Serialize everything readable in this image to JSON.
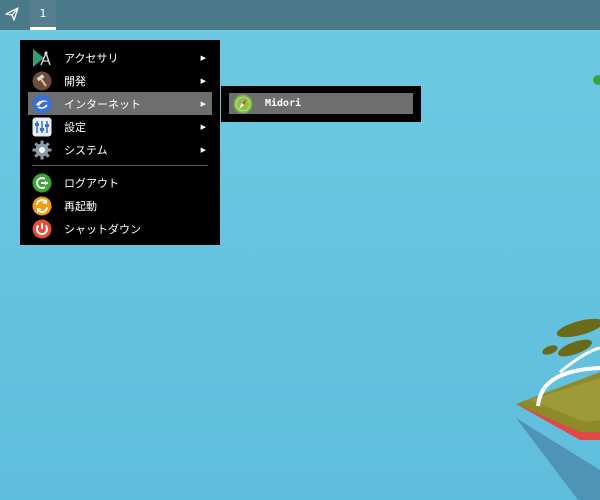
{
  "panel": {
    "workspace_label": "1",
    "launcher_icon": "paper-plane-icon"
  },
  "menu": {
    "items": [
      {
        "label": "アクセサリ",
        "icon": "accessories-icon",
        "has_submenu": true
      },
      {
        "label": "開発",
        "icon": "development-icon",
        "has_submenu": true
      },
      {
        "label": "インターネット",
        "icon": "internet-icon",
        "has_submenu": true,
        "active": true
      },
      {
        "label": "設定",
        "icon": "settings-icon",
        "has_submenu": true
      },
      {
        "label": "システム",
        "icon": "system-gear-icon",
        "has_submenu": true
      }
    ],
    "actions": [
      {
        "label": "ログアウト",
        "icon": "logout-icon"
      },
      {
        "label": "再起動",
        "icon": "restart-icon"
      },
      {
        "label": "シャットダウン",
        "icon": "shutdown-icon"
      }
    ],
    "arrow_glyph": "▶"
  },
  "submenu": {
    "items": [
      {
        "label": "Midori",
        "icon": "midori-browser-icon"
      }
    ]
  },
  "colors": {
    "desktop_bg": "#6bc6e0",
    "panel_bg": "#4a7a8a",
    "menu_bg": "#000000",
    "menu_active_bg": "#6e6e6e",
    "logout_green": "#3aa635",
    "restart_orange": "#f39c12",
    "shutdown_red": "#e74c3c"
  }
}
